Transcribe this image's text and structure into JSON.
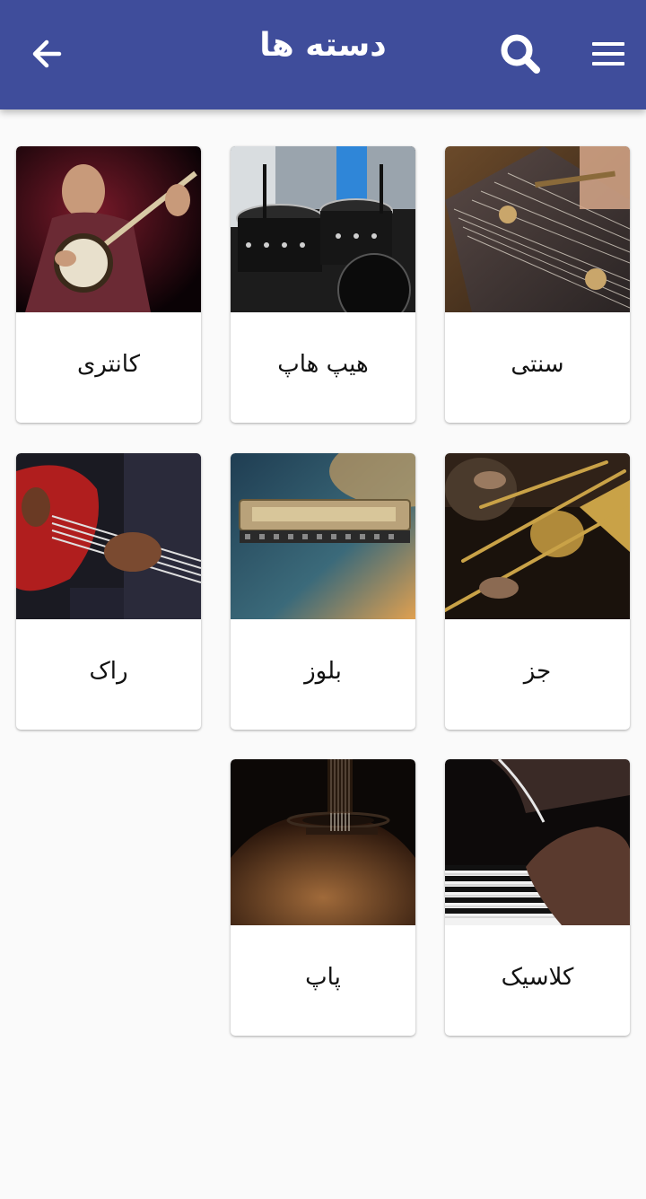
{
  "appbar": {
    "title": "دسته ها",
    "background": "#3f4d9b",
    "back_icon": "arrow-left-icon",
    "search_icon": "search-icon",
    "menu_icon": "hamburger-menu-icon"
  },
  "categories": [
    {
      "label": "سنتی"
    },
    {
      "label": "هیپ هاپ"
    },
    {
      "label": "کانتری"
    },
    {
      "label": "جز"
    },
    {
      "label": "بلوز"
    },
    {
      "label": "راک"
    },
    {
      "label": "کلاسیک"
    },
    {
      "label": "پاپ"
    }
  ]
}
